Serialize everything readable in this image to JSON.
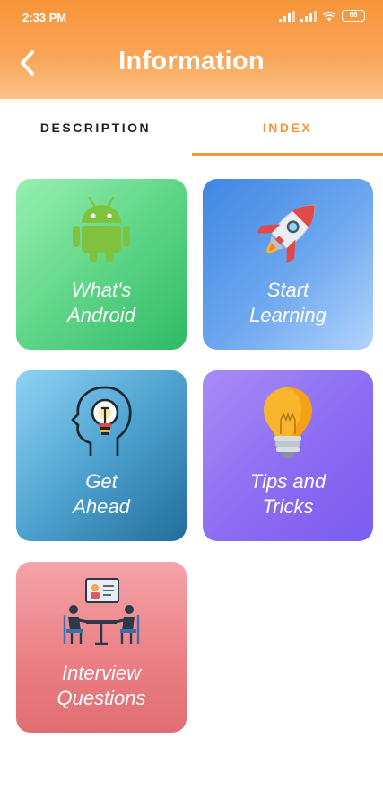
{
  "status_bar": {
    "time": "2:33 PM",
    "battery": "66"
  },
  "header": {
    "title": "Information",
    "back_icon": "chevron-left-icon"
  },
  "tabs": [
    {
      "label": "DESCRIPTION",
      "active": false
    },
    {
      "label": "INDEX",
      "active": true
    }
  ],
  "cards": [
    {
      "label": "What's\nAndroid",
      "icon": "android-robot-icon"
    },
    {
      "label": "Start\nLearning",
      "icon": "rocket-icon"
    },
    {
      "label": "Get\nAhead",
      "icon": "head-lightbulb-icon"
    },
    {
      "label": "Tips and\nTricks",
      "icon": "lightbulb-icon"
    },
    {
      "label": "Interview\nQuestions",
      "icon": "interview-icon"
    }
  ],
  "colors": {
    "accent": "#f7953a",
    "card_android": "#5fd687",
    "card_learning": "#6ea8ef",
    "card_ahead": "#4ea2cf",
    "card_tips": "#8b6cf2",
    "card_interview": "#ea7e83"
  }
}
